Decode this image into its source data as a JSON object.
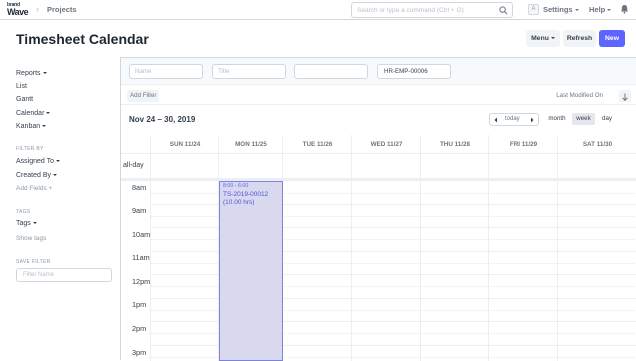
{
  "navbar": {
    "logo_top": "brand",
    "logo_bottom": "Wave",
    "breadcrumb": "Projects",
    "search_placeholder": "Search or type a command (Ctrl + G)",
    "avatar_initial": "A",
    "settings_label": "Settings",
    "help_label": "Help"
  },
  "page": {
    "title": "Timesheet Calendar",
    "menu_label": "Menu",
    "refresh_label": "Refresh",
    "new_label": "New"
  },
  "sidebar": {
    "reports": "Reports",
    "list": "List",
    "gantt": "Gantt",
    "calendar": "Calendar",
    "kanban": "Kanban",
    "filter_by_heading": "FILTER BY",
    "assigned_to": "Assigned To",
    "created_by": "Created By",
    "add_fields": "Add Fields",
    "tags_heading": "TAGS",
    "tags": "Tags",
    "show_tags": "Show tags",
    "save_filter_heading": "SAVE FILTER",
    "filter_name_placeholder": "Filter Name"
  },
  "filters": {
    "name_placeholder": "Name",
    "title_placeholder": "Title",
    "third_value": "",
    "employee_value": "HR-EMP-00006",
    "add_filter": "Add Filter",
    "sort_label": "Last Modified On"
  },
  "calendar": {
    "range_title": "Nov 24 – 30, 2019",
    "today_label": "today",
    "views": [
      "month",
      "week",
      "day"
    ],
    "active_view": "week",
    "days": [
      "SUN 11/24",
      "MON 11/25",
      "TUE 11/26",
      "WED 11/27",
      "THU 11/28",
      "FRI 11/29",
      "SAT 11/30"
    ],
    "allday_label": "all-day",
    "hours": [
      "8am",
      "9am",
      "10am",
      "11am",
      "12pm",
      "1pm",
      "2pm",
      "3pm"
    ],
    "event": {
      "time": "8:00 - 6:00",
      "name": "TS-2019-00012",
      "hours": "(10.00 hrs)"
    }
  },
  "colors": {
    "primary": "#5e64ff",
    "event_bg": "#d8d8ee",
    "border": "#d1d8dd"
  }
}
